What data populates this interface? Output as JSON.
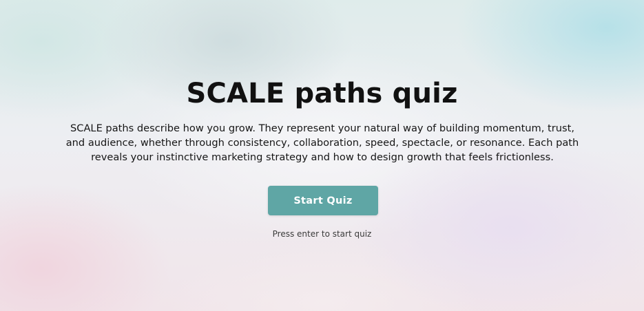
{
  "hero": {
    "title": "SCALE paths quiz",
    "description": "SCALE paths describe how you grow. They represent your natural way of building momentum, trust, and audience, whether through consistency, collaboration, speed, spectacle, or resonance. Each path reveals your instinctive marketing strategy and how to design growth that feels frictionless.",
    "start_button_label": "Start Quiz",
    "hint": "Press enter to start quiz"
  },
  "colors": {
    "accent": "#5fa6a5",
    "title_text": "#111111",
    "body_text": "#161616"
  }
}
